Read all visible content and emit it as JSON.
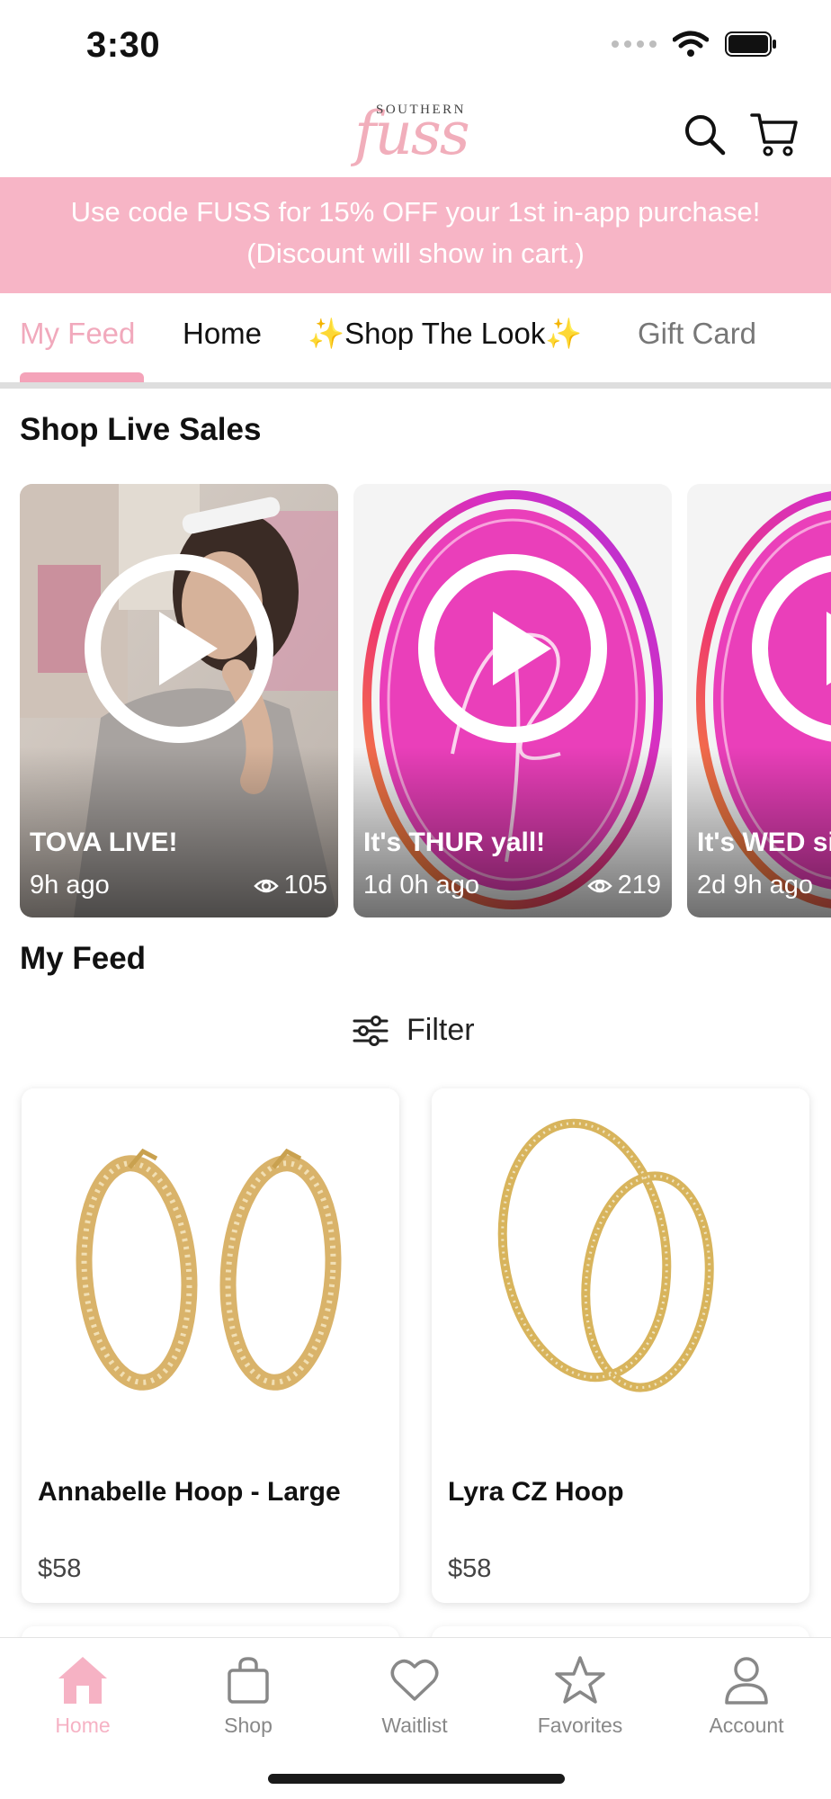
{
  "status_bar": {
    "time": "3:30"
  },
  "header": {
    "logo_top": "SOUTHERN",
    "logo_main": "fuss"
  },
  "promo": {
    "line1": "Use code FUSS for 15% OFF your 1st in-app purchase!",
    "line2": "(Discount will show in cart.)"
  },
  "tabs": [
    {
      "label": "My Feed"
    },
    {
      "label": "Home"
    },
    {
      "label": "✨Shop The Look✨"
    },
    {
      "label": "Gift Card"
    }
  ],
  "live_section": {
    "title": "Shop Live Sales",
    "cards": [
      {
        "title": "TOVA LIVE!",
        "time": "9h ago",
        "views": "105"
      },
      {
        "title": "It's THUR yall!",
        "time": "1d 0h ago",
        "views": "219"
      },
      {
        "title": "It's WED si",
        "time": "2d 9h ago"
      }
    ]
  },
  "feed_section": {
    "title": "My Feed",
    "filter_label": "Filter"
  },
  "products": [
    {
      "name": "Annabelle Hoop - Large",
      "price": "$58"
    },
    {
      "name": "Lyra CZ Hoop",
      "price": "$58"
    }
  ],
  "bottom_nav": [
    {
      "label": "Home",
      "icon": "home-icon"
    },
    {
      "label": "Shop",
      "icon": "bag-icon"
    },
    {
      "label": "Waitlist",
      "icon": "heart-icon"
    },
    {
      "label": "Favorites",
      "icon": "star-icon"
    },
    {
      "label": "Account",
      "icon": "person-icon"
    }
  ],
  "colors": {
    "brand_pink": "#f7b5c6",
    "accent_pink": "#f1a9bc",
    "live_magenta": "#e83fb8"
  }
}
